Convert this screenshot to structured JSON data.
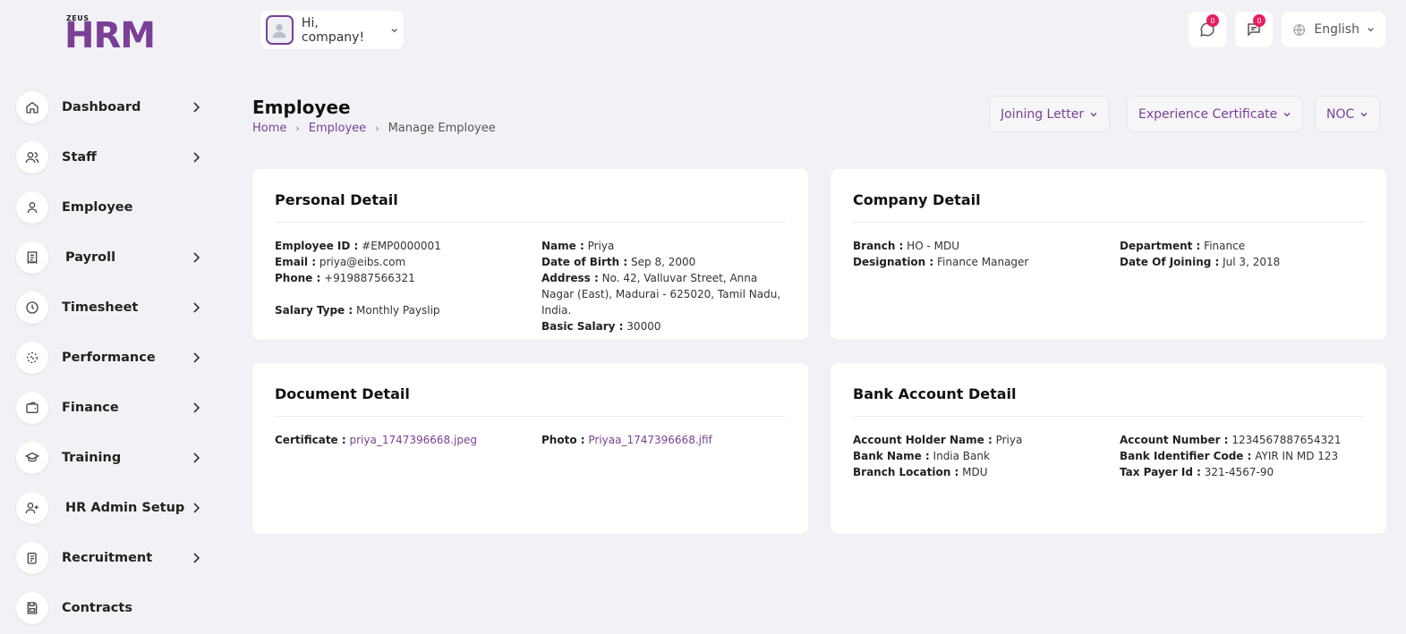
{
  "logo": {
    "small": "ZEUS",
    "main": "HRM"
  },
  "sidebar": {
    "items": [
      {
        "label": "Dashboard",
        "icon": "home-icon",
        "has_children": true
      },
      {
        "label": "Staff",
        "icon": "users-icon",
        "has_children": true
      },
      {
        "label": "Employee",
        "icon": "user-icon",
        "has_children": false
      },
      {
        "label": "Payroll",
        "icon": "receipt-icon",
        "has_children": true
      },
      {
        "label": "Timesheet",
        "icon": "clock-icon",
        "has_children": true
      },
      {
        "label": "Performance",
        "icon": "target-icon",
        "has_children": true
      },
      {
        "label": "Finance",
        "icon": "wallet-icon",
        "has_children": true
      },
      {
        "label": "Training",
        "icon": "graduation-cap-icon",
        "has_children": true
      },
      {
        "label": "HR Admin Setup",
        "icon": "user-plus-icon",
        "has_children": true
      },
      {
        "label": "Recruitment",
        "icon": "clipboard-icon",
        "has_children": true
      },
      {
        "label": "Contracts",
        "icon": "file-save-icon",
        "has_children": false
      }
    ]
  },
  "header": {
    "greeting": "Hi, company!",
    "messages_count": "0",
    "notifications_count": "0",
    "language": "English"
  },
  "page": {
    "title": "Employee",
    "breadcrumb": {
      "home": "Home",
      "section": "Employee",
      "current": "Manage Employee"
    },
    "actions": {
      "joining_letter": "Joining Letter",
      "experience_certificate": "Experience Certificate",
      "noc": "NOC"
    }
  },
  "personal": {
    "title": "Personal Detail",
    "employee_id_label": "Employee ID :",
    "employee_id": "#EMP0000001",
    "email_label": "Email :",
    "email": "priya@eibs.com",
    "phone_label": "Phone :",
    "phone": "+919887566321",
    "salary_type_label": "Salary Type :",
    "salary_type": "Monthly Payslip",
    "name_label": "Name :",
    "name": "Priya",
    "dob_label": "Date of Birth :",
    "dob": "Sep 8, 2000",
    "address_label": "Address :",
    "address": "No. 42, Valluvar Street, Anna Nagar (East), Madurai - 625020, Tamil Nadu, India.",
    "basic_salary_label": "Basic Salary :",
    "basic_salary": "30000"
  },
  "company": {
    "title": "Company Detail",
    "branch_label": "Branch :",
    "branch": "HO - MDU",
    "designation_label": "Designation :",
    "designation": "Finance Manager",
    "department_label": "Department :",
    "department": "Finance",
    "doj_label": "Date Of Joining :",
    "doj": "Jul 3, 2018"
  },
  "document": {
    "title": "Document Detail",
    "certificate_label": "Certificate :",
    "certificate": "priya_1747396668.jpeg",
    "photo_label": "Photo :",
    "photo": "Priyaa_1747396668.jfif"
  },
  "bank": {
    "title": "Bank Account Detail",
    "holder_label": "Account Holder Name :",
    "holder": "Priya",
    "bank_name_label": "Bank Name :",
    "bank_name": "India Bank",
    "branch_location_label": "Branch Location :",
    "branch_location": "MDU",
    "account_number_label": "Account Number :",
    "account_number": "1234567887654321",
    "bic_label": "Bank Identifier Code :",
    "bic": "AYIR IN MD 123",
    "tax_id_label": "Tax Payer Id :",
    "tax_id": "321-4567-90"
  },
  "colors": {
    "accent": "#7b3f96",
    "badge": "#e91e63",
    "background": "#f2f2f6"
  }
}
